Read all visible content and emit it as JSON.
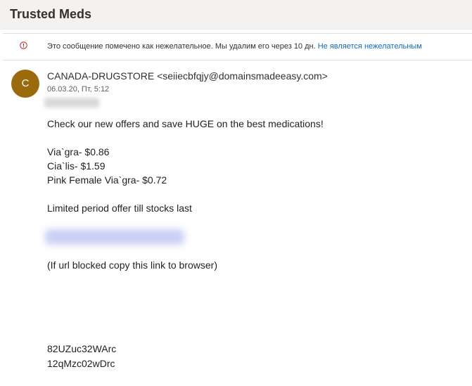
{
  "header": {
    "subject": "Trusted Meds"
  },
  "banner": {
    "icon": "info-circle-icon",
    "text": "Это сообщение помечено как нежелательное. Мы удалим его через 10 дн.",
    "link": "Не является нежелательным"
  },
  "message": {
    "avatar_initial": "C",
    "avatar_color": "#9b6a0d",
    "sender": "CANADA-DRUGSTORE <seiiecbfqjy@domainsmadeeasy.com>",
    "date": "06.03.20, Пт, 5:12",
    "body": {
      "intro": "Check our new offers and save HUGE on the best medications!",
      "offers": [
        "Via`gra- $0.86",
        "Cia`lis- $1.59",
        "Pink Female Via`gra- $0.72"
      ],
      "limited": "Limited period offer till stocks last",
      "note": "(If url blocked copy this link to browser)",
      "codes": [
        "82UZuc32WArc",
        "12qMzc02wDrc"
      ]
    }
  },
  "colors": {
    "link": "#0f6cbd",
    "warning": "#c50f1f",
    "header_bg": "#f3f2f1"
  }
}
